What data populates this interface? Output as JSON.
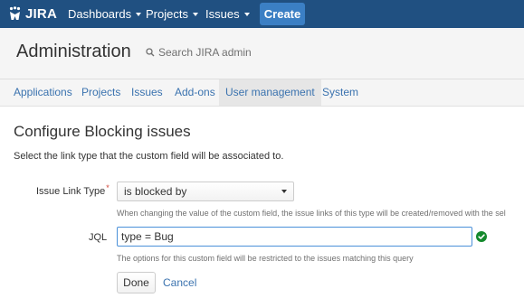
{
  "topbar": {
    "logo_text": "JIRA",
    "nav": [
      {
        "label": "Dashboards"
      },
      {
        "label": "Projects"
      },
      {
        "label": "Issues"
      }
    ],
    "create_label": "Create"
  },
  "admin": {
    "title": "Administration",
    "search_placeholder": "Search JIRA admin"
  },
  "tabs": [
    {
      "label": "Applications"
    },
    {
      "label": "Projects"
    },
    {
      "label": "Issues"
    },
    {
      "label": "Add-ons"
    },
    {
      "label": "User management"
    },
    {
      "label": "System"
    }
  ],
  "page": {
    "heading": "Configure Blocking issues",
    "description": "Select the link type that the custom field will be associated to."
  },
  "form": {
    "link_type_label": "Issue Link Type",
    "required_marker": "*",
    "link_type_value": "is blocked by",
    "link_type_help": "When changing the value of the custom field, the issue links of this type will be created/removed with the sel",
    "jql_label": "JQL",
    "jql_value": "type = Bug",
    "jql_help": "The options for this custom field will be restricted to the issues matching this query",
    "done_label": "Done",
    "cancel_label": "Cancel"
  },
  "colors": {
    "header_bg": "#205081",
    "create_button": "#3b7fc4",
    "link": "#3b73af",
    "valid_check": "#14892c",
    "required": "#d04437"
  }
}
